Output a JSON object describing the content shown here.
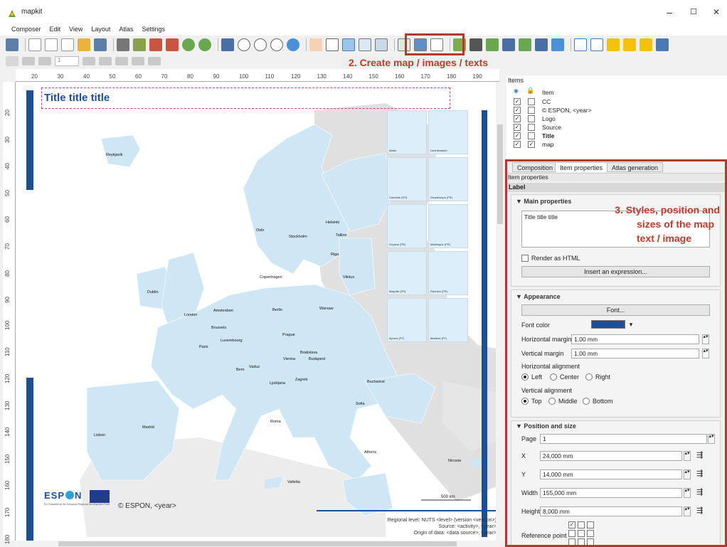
{
  "window": {
    "title": "mapkit",
    "min": "–",
    "max": "☐",
    "close": "✕"
  },
  "menu": [
    "Composer",
    "Edit",
    "View",
    "Layout",
    "Atlas",
    "Settings"
  ],
  "page_field": "1",
  "annotations": {
    "create": "2. Create map / images / texts",
    "styles_l1": "3. Styles, position and",
    "styles_l2": "sizes of the map",
    "styles_l3": "text / image"
  },
  "ruler_h": [
    "20",
    "30",
    "40",
    "50",
    "60",
    "70",
    "80",
    "90",
    "100",
    "110",
    "120",
    "130",
    "140",
    "150",
    "160",
    "170",
    "180",
    "190"
  ],
  "ruler_v": [
    "20",
    "30",
    "40",
    "50",
    "60",
    "70",
    "80",
    "90",
    "100",
    "110",
    "120",
    "130",
    "140",
    "150",
    "160",
    "170",
    "180"
  ],
  "canvas": {
    "title": "Title title title",
    "espon_logo": "ESP",
    "espon_logo_n": "N",
    "espon_sub": "EU Financed by the European Regional Development Fund",
    "copyright": "© ESPON, <year>",
    "scale": "500 km",
    "source_l1": "Regional level: NUTS <level> (version <version>)",
    "source_l2": "Source: <activity>, <year>",
    "source_l3": "Origin of data: <data source>, <year>",
    "cities": [
      "Reykjavik",
      "Oslo",
      "Stockholm",
      "Helsinki",
      "Tallinn",
      "Riga",
      "Vilnius",
      "Copenhagen",
      "Dublin",
      "London",
      "Amsterdam",
      "Brussels",
      "Luxembourg",
      "Paris",
      "Berlin",
      "Warsaw",
      "Prague",
      "Bern",
      "Vaduz",
      "Vienna",
      "Bratislava",
      "Budapest",
      "Ljubljana",
      "Zagreb",
      "Bucharest",
      "Sofia",
      "Roma",
      "Madrid",
      "Lisbon",
      "Athens",
      "Nicosia",
      "Valletta"
    ],
    "insets": [
      "Malta",
      "Liechtenstein",
      "Canarias (ES)",
      "Guadeloupe (FR)",
      "Guyane (FR)",
      "Martinique (FR)",
      "Mayotte (FR)",
      "Réunion (FR)",
      "Açores (PT)",
      "Madeira (PT)"
    ]
  },
  "items_panel": {
    "header": "Items",
    "col_item": "Item",
    "rows": [
      {
        "name": "CC",
        "visible": true,
        "locked": false,
        "bold": false
      },
      {
        "name": "© ESPON, <year>",
        "visible": true,
        "locked": false,
        "bold": false
      },
      {
        "name": "Logo",
        "visible": true,
        "locked": false,
        "bold": false
      },
      {
        "name": "Source",
        "visible": true,
        "locked": false,
        "bold": false
      },
      {
        "name": "Title",
        "visible": true,
        "locked": false,
        "bold": true
      },
      {
        "name": "map",
        "visible": true,
        "locked": true,
        "bold": false
      }
    ]
  },
  "props": {
    "tabs": [
      "Composition",
      "Item properties",
      "Atlas generation"
    ],
    "active_tab": "Item properties",
    "subheader": "Item properties",
    "label_header": "Label",
    "main_props": "Main properties",
    "text_value": "Title title title",
    "render_html": "Render as HTML",
    "insert_expr": "Insert an expression...",
    "appearance": "Appearance",
    "font_btn": "Font...",
    "font_color_lbl": "Font color",
    "font_color": "#1f4e99",
    "hmargin_lbl": "Horizontal margin",
    "hmargin": "1,00 mm",
    "vmargin_lbl": "Vertical margin",
    "vmargin": "1,00 mm",
    "halign_lbl": "Horizontal alignment",
    "halign": [
      "Left",
      "Center",
      "Right"
    ],
    "valign_lbl": "Vertical alignment",
    "valign": [
      "Top",
      "Middle",
      "Bottom"
    ],
    "pos_size": "Position and size",
    "page_lbl": "Page",
    "page": "1",
    "x_lbl": "X",
    "x": "24,000 mm",
    "y_lbl": "Y",
    "y": "14,000 mm",
    "w_lbl": "Width",
    "w": "155,000 mm",
    "h_lbl": "Height",
    "h": "8,000 mm",
    "ref_lbl": "Reference point"
  },
  "colors": {
    "accent": "#b03a2e",
    "espon_blue": "#1f4e99",
    "land": "#cfe6f5",
    "sea": "#ffffff",
    "nonEU": "#e0e0e0"
  }
}
